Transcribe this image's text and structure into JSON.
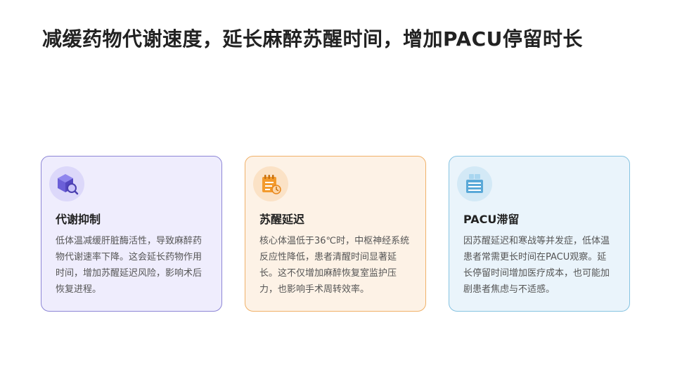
{
  "title": "减缓药物代谢速度，延长麻醉苏醒时间，增加PACU停留时长",
  "cards": [
    {
      "icon": "cube-search-icon",
      "title": "代谢抑制",
      "desc": "低体温减缓肝脏酶活性，导致麻醉药物代谢速率下降。这会延长药物作用时间，增加苏醒延迟风险，影响术后恢复进程。",
      "accent": "#7b6fe0"
    },
    {
      "icon": "notepad-clock-icon",
      "title": "苏醒延迟",
      "desc": "核心体温低于36℃时，中枢神经系统反应性降低，患者清醒时间显著延长。这不仅增加麻醉恢复室监护压力，也影响手术周转效率。",
      "accent": "#f39a2c"
    },
    {
      "icon": "monitor-stack-icon",
      "title": "PACU滞留",
      "desc": "因苏醒延迟和寒战等并发症，低体温患者常需更长时间在PACU观察。延长停留时间增加医疗成本，也可能加剧患者焦虑与不适感。",
      "accent": "#5aa9d8"
    }
  ]
}
